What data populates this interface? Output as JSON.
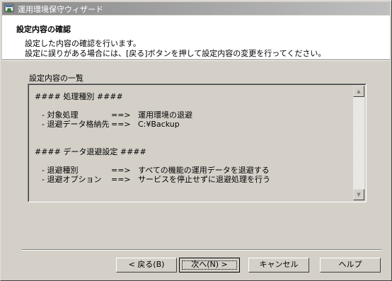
{
  "window": {
    "title": "運用環境保守ウィザード"
  },
  "header": {
    "heading": "設定内容の確認",
    "line1": "設定した内容の確認を行います。",
    "line2": "設定に誤りがある場合には、[戻る]ボタンを押して設定内容の変更を行ってください。"
  },
  "group": {
    "label": "設定内容の一覧"
  },
  "summary": {
    "section1": {
      "header": "####  処理種別  ####",
      "rows": [
        {
          "key": "- 対象処理",
          "arrow": "==>",
          "value": "運用環境の退避"
        },
        {
          "key": "- 退避データ格納先",
          "arrow": "==>",
          "value": "C:¥Backup"
        }
      ]
    },
    "section2": {
      "header": "####  データ退避設定  ####",
      "rows": [
        {
          "key": "- 退避種別",
          "arrow": "==>",
          "value": "すべての機能の運用データを退避する"
        },
        {
          "key": "- 退避オプション",
          "arrow": "==>",
          "value": "サービスを停止せずに退避処理を行う"
        }
      ]
    }
  },
  "buttons": {
    "back": "< 戻る(B)",
    "next": "次へ(N) >",
    "cancel": "キャンセル",
    "help": "ヘルプ"
  },
  "icons": {
    "app": "wizard-app-icon",
    "scroll_up": "scroll-up-arrow-icon",
    "scroll_down": "scroll-down-arrow-icon"
  }
}
